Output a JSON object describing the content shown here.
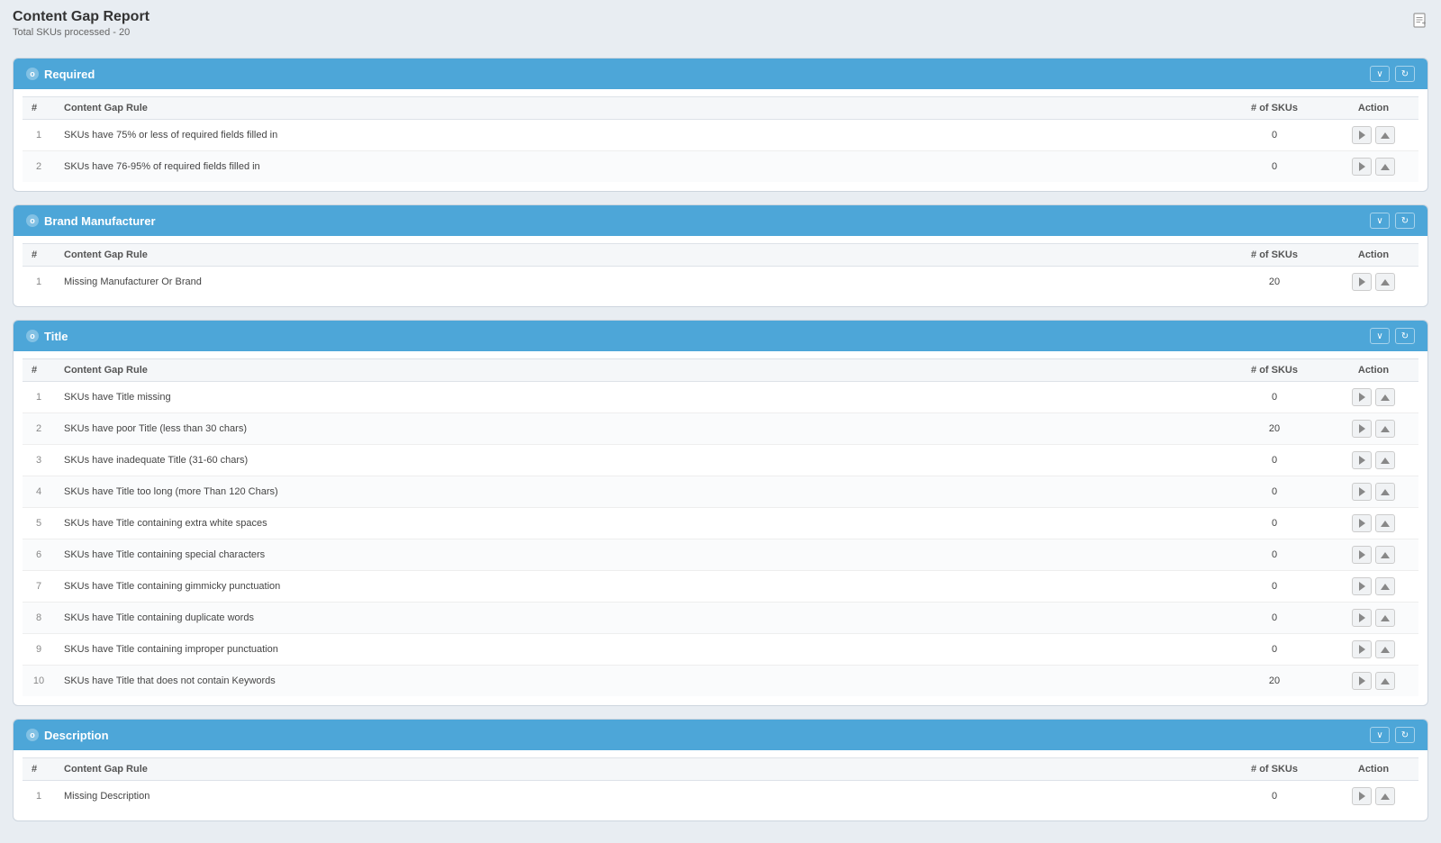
{
  "page": {
    "title": "Content Gap Report",
    "subtitle": "Total SKUs processed - 20",
    "export_icon": "📄"
  },
  "sections": [
    {
      "id": "required",
      "label": "Required",
      "rows": [
        {
          "num": 1,
          "rule": "SKUs have 75% or less of required fields filled in",
          "skus": 0
        },
        {
          "num": 2,
          "rule": "SKUs have 76-95% of required fields filled in",
          "skus": 0
        }
      ]
    },
    {
      "id": "brand-manufacturer",
      "label": "Brand Manufacturer",
      "rows": [
        {
          "num": 1,
          "rule": "Missing Manufacturer Or Brand",
          "skus": 20
        }
      ]
    },
    {
      "id": "title",
      "label": "Title",
      "rows": [
        {
          "num": 1,
          "rule": "SKUs have Title missing",
          "skus": 0
        },
        {
          "num": 2,
          "rule": "SKUs have poor Title (less than 30 chars)",
          "skus": 20
        },
        {
          "num": 3,
          "rule": "SKUs have inadequate Title (31-60 chars)",
          "skus": 0
        },
        {
          "num": 4,
          "rule": "SKUs have Title too long (more Than 120 Chars)",
          "skus": 0
        },
        {
          "num": 5,
          "rule": "SKUs have Title containing extra white spaces",
          "skus": 0
        },
        {
          "num": 6,
          "rule": "SKUs have Title containing special characters",
          "skus": 0
        },
        {
          "num": 7,
          "rule": "SKUs have Title containing gimmicky punctuation",
          "skus": 0
        },
        {
          "num": 8,
          "rule": "SKUs have Title containing duplicate words",
          "skus": 0
        },
        {
          "num": 9,
          "rule": "SKUs have Title containing improper punctuation",
          "skus": 0
        },
        {
          "num": 10,
          "rule": "SKUs have Title that does not contain Keywords",
          "skus": 20
        }
      ]
    },
    {
      "id": "description",
      "label": "Description",
      "rows": [
        {
          "num": 1,
          "rule": "Missing Description",
          "skus": 0
        }
      ]
    }
  ],
  "table": {
    "col_num": "#",
    "col_rule": "Content Gap Rule",
    "col_skus": "# of SKUs",
    "col_action": "Action"
  }
}
